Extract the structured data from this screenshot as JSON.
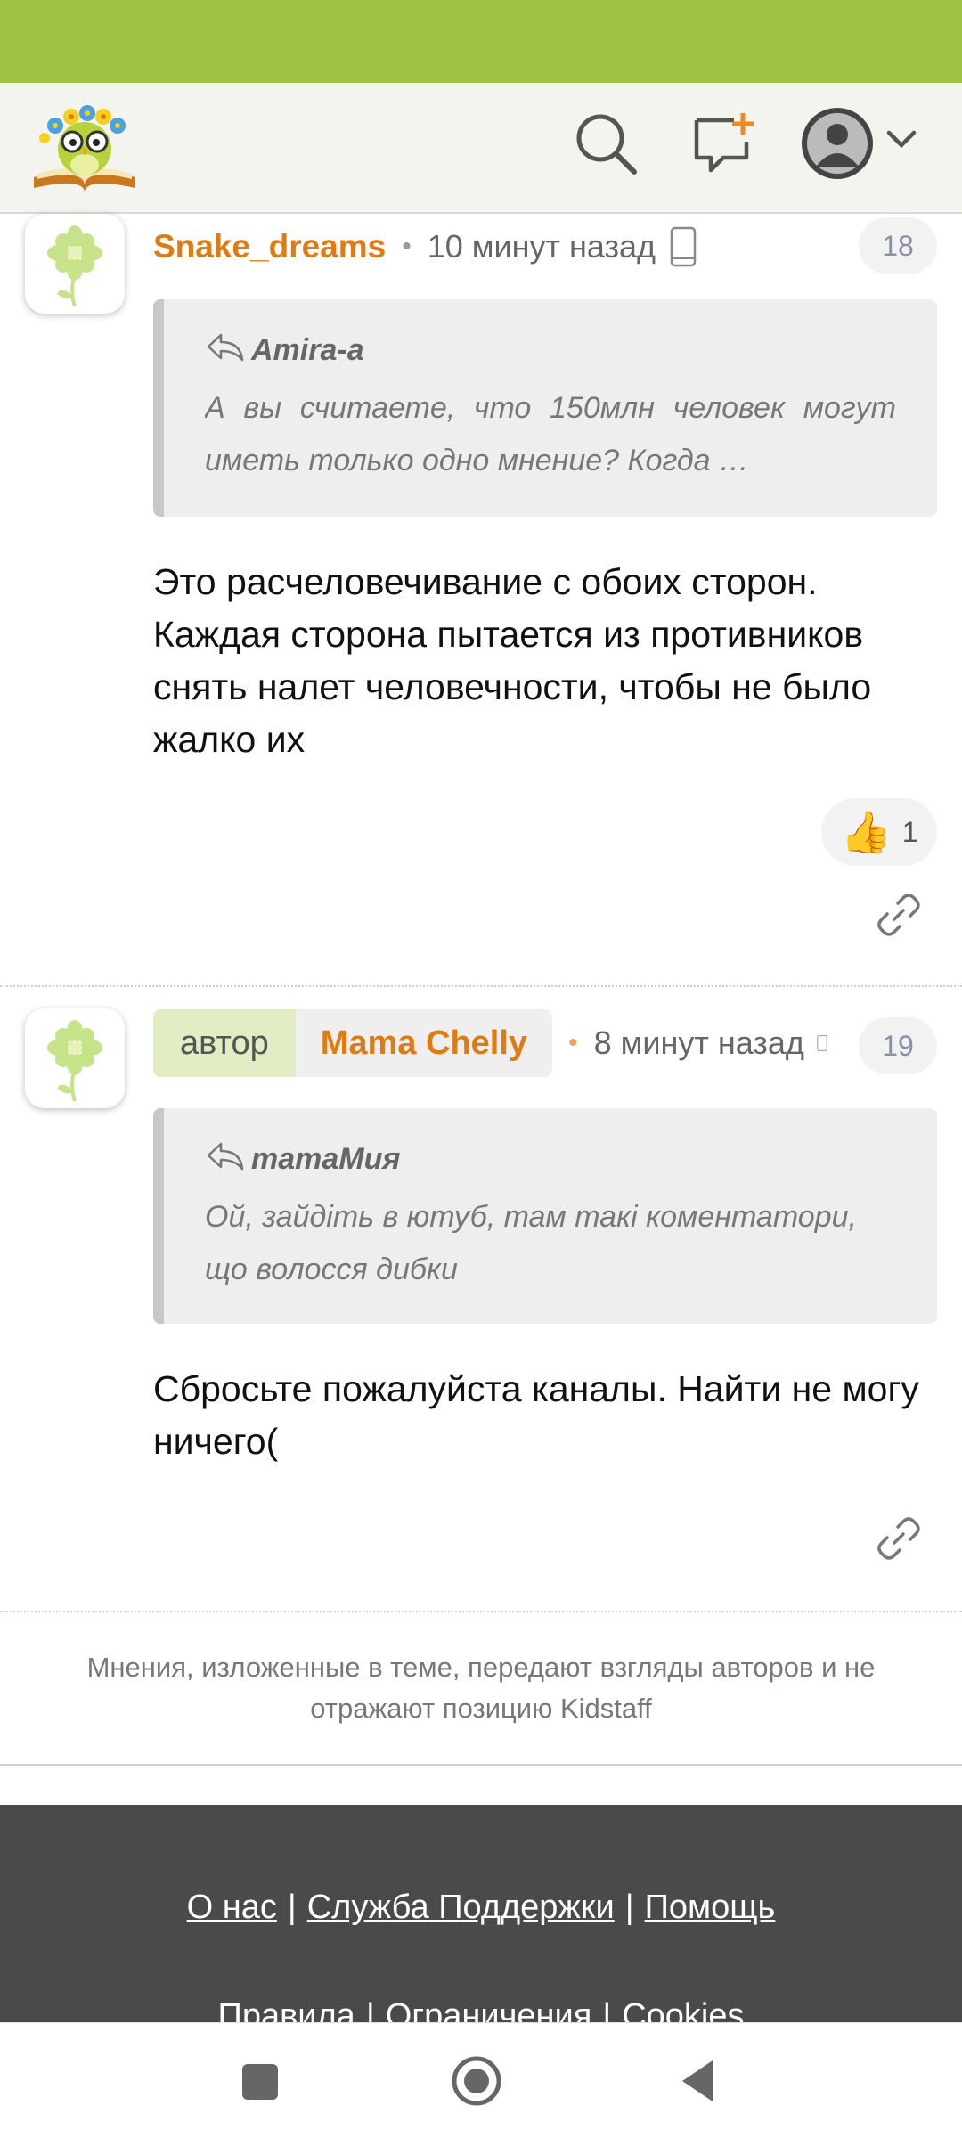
{
  "colors": {
    "accent_green": "#9dc143",
    "author_orange": "#e07b12",
    "footer_bg": "#4a4a4a"
  },
  "header": {
    "logo_icon": "owl-with-flowers-on-book-logo",
    "search_icon": "search-icon",
    "new_post_icon": "new-message-plus-icon",
    "profile_icon": "user-avatar-icon",
    "menu_icon": "chevron-down-icon"
  },
  "posts": [
    {
      "author": "Snake_dreams",
      "time": "10 минут назад",
      "device_icon": "mobile-phone-icon",
      "number": "18",
      "quote": {
        "author": "Amira-a",
        "text": "А вы считаете, что 150млн человек могут иметь только одно мнение? Когда …"
      },
      "body": "Это расчеловечивание с обоих сторон. Каждая сторона пытается из противников снять налет человечности, чтобы не было жалко их",
      "likes": "1"
    },
    {
      "author_tag": "автор",
      "author": "Mama Chelly",
      "time": "8 минут назад",
      "number": "19",
      "quote": {
        "author": "mamaМия",
        "text": "Ой, зайдіть в ютуб, там такі коментатори, що волосся дибки"
      },
      "body": "Сбросьте пожалуйста каналы. Найти не могу ничего("
    }
  ],
  "disclaimer": "Мнения, изложенные в теме, передают взгляды авторов и не отражают позицию Kidstaff",
  "footer": {
    "row1": [
      "О нас",
      "Служба Поддержки",
      "Помощь"
    ],
    "row2": [
      "Правила",
      "Ограничения",
      "Cookies"
    ],
    "separator": "|"
  }
}
